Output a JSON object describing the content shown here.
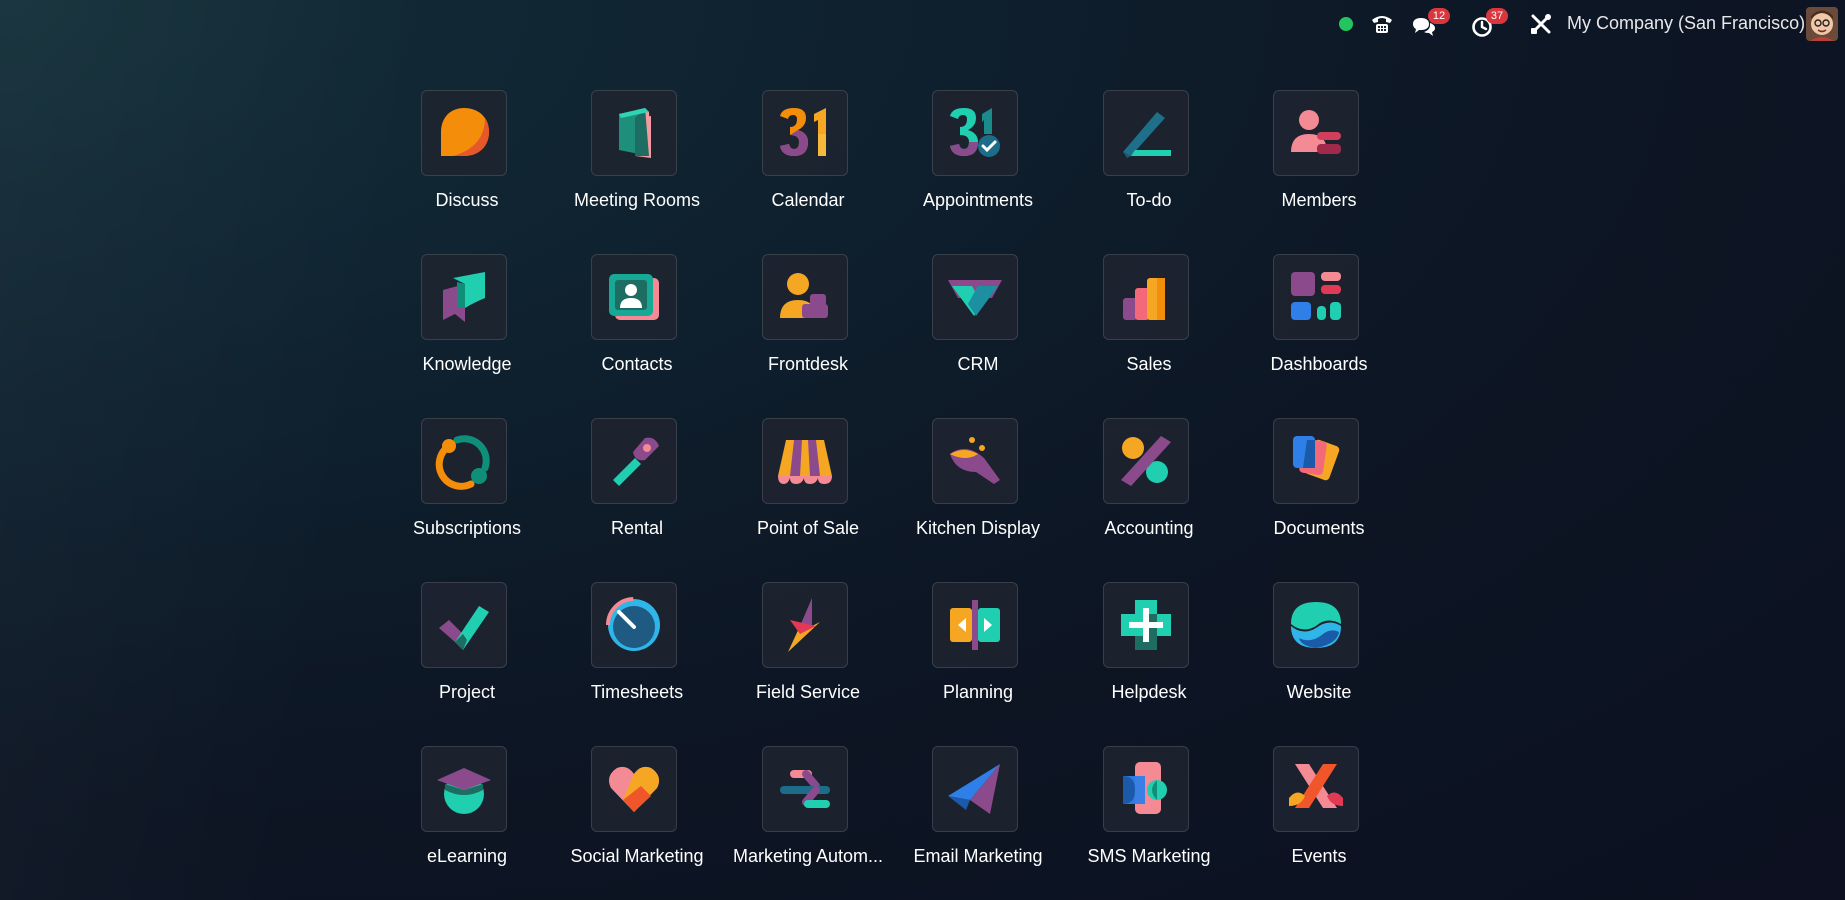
{
  "topbar": {
    "status_color": "#22c55e",
    "messages_badge": "12",
    "activities_badge": "37",
    "company": "My Company (San Francisco)",
    "icons": [
      "status-dot-icon",
      "phone-icon",
      "chat-icon",
      "clock-icon",
      "tools-icon",
      "user-avatar"
    ]
  },
  "apps": [
    {
      "label": "Discuss",
      "icon": "discuss-icon"
    },
    {
      "label": "Meeting Rooms",
      "icon": "meeting-rooms-icon"
    },
    {
      "label": "Calendar",
      "icon": "calendar-icon"
    },
    {
      "label": "Appointments",
      "icon": "appointments-icon"
    },
    {
      "label": "To-do",
      "icon": "todo-icon"
    },
    {
      "label": "Members",
      "icon": "members-icon"
    },
    {
      "label": "Knowledge",
      "icon": "knowledge-icon"
    },
    {
      "label": "Contacts",
      "icon": "contacts-icon"
    },
    {
      "label": "Frontdesk",
      "icon": "frontdesk-icon"
    },
    {
      "label": "CRM",
      "icon": "crm-icon"
    },
    {
      "label": "Sales",
      "icon": "sales-icon"
    },
    {
      "label": "Dashboards",
      "icon": "dashboards-icon"
    },
    {
      "label": "Subscriptions",
      "icon": "subscriptions-icon"
    },
    {
      "label": "Rental",
      "icon": "rental-icon"
    },
    {
      "label": "Point of Sale",
      "icon": "point-of-sale-icon"
    },
    {
      "label": "Kitchen Display",
      "icon": "kitchen-display-icon"
    },
    {
      "label": "Accounting",
      "icon": "accounting-icon"
    },
    {
      "label": "Documents",
      "icon": "documents-icon"
    },
    {
      "label": "Project",
      "icon": "project-icon"
    },
    {
      "label": "Timesheets",
      "icon": "timesheets-icon"
    },
    {
      "label": "Field Service",
      "icon": "field-service-icon"
    },
    {
      "label": "Planning",
      "icon": "planning-icon"
    },
    {
      "label": "Helpdesk",
      "icon": "helpdesk-icon"
    },
    {
      "label": "Website",
      "icon": "website-icon"
    },
    {
      "label": "eLearning",
      "icon": "elearning-icon"
    },
    {
      "label": "Social Marketing",
      "icon": "social-marketing-icon"
    },
    {
      "label": "Marketing Autom...",
      "icon": "marketing-automation-icon"
    },
    {
      "label": "Email Marketing",
      "icon": "email-marketing-icon"
    },
    {
      "label": "SMS Marketing",
      "icon": "sms-marketing-icon"
    },
    {
      "label": "Events",
      "icon": "events-icon"
    }
  ]
}
